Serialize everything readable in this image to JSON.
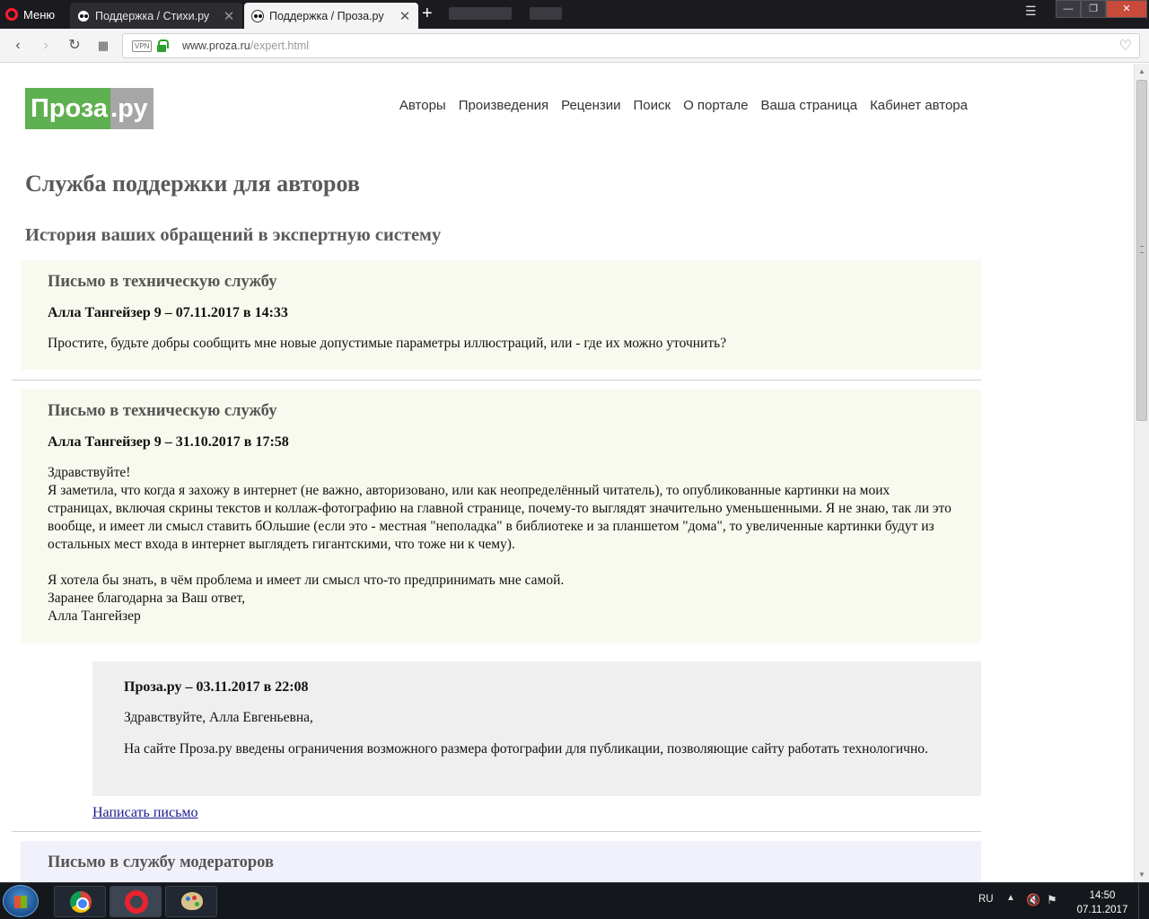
{
  "browser": {
    "menu_label": "Меню",
    "tabs": [
      {
        "label": "Поддержка / Стихи.ру"
      },
      {
        "label": "Поддержка / Проза.ру"
      }
    ],
    "new_tab": "+",
    "url_host": "www.proza.ru",
    "url_path": "/expert.html",
    "vpn_label": "VPN"
  },
  "site": {
    "logo_left": "Проза",
    "logo_dot": ".",
    "logo_right": "ру",
    "nav": [
      "Авторы",
      "Произведения",
      "Рецензии",
      "Поиск",
      "О портале",
      "Ваша страница",
      "Кабинет автора"
    ]
  },
  "page": {
    "title": "Служба поддержки для авторов",
    "subtitle": "История ваших обращений в экспертную систему"
  },
  "letters": [
    {
      "title": "Письмо в техническую службу",
      "meta": "Алла Тангейзер 9 – 07.11.2017 в 14:33",
      "text": "Простите, будьте добры сообщить мне новые допустимые параметры иллюстраций, или - где их можно уточнить?"
    },
    {
      "title": "Письмо в техническую службу",
      "meta": "Алла Тангейзер 9 – 31.10.2017 в 17:58",
      "text": "Здравствуйте!\nЯ заметила, что когда я захожу в интернет (не важно, авторизовано, или как неопределённый читатель), то опубликованные картинки на моих страницах, включая скрины текстов и коллаж-фотографию на главной странице, почему-то выглядят значительно уменьшенными. Я не знаю, так ли это вообще, и имеет ли смысл ставить бОльшие (если это - местная \"неполадка\" в библиотеке и за планшетом \"дома\", то увеличенные картинки будут из остальных мест входа в интернет выглядеть гигантскими, что тоже ни к чему).\n\nЯ хотела бы знать, в чём проблема и имеет ли смысл что-то предпринимать мне самой.\nЗаранее благодарна за Ваш ответ,\nАлла Тангейзер"
    },
    {
      "title": "Письмо в службу модераторов"
    }
  ],
  "reply": {
    "meta": "Проза.ру – 03.11.2017 в 22:08",
    "greeting": "Здравствуйте, Алла Евгеньевна,",
    "body": "На сайте Проза.ру введены ограничения возможного размера фотографии для публикации, позволяющие сайту работать технологично."
  },
  "write_letter_link": "Написать письмо",
  "taskbar": {
    "lang": "RU",
    "time": "14:50",
    "date": "07.11.2017"
  }
}
